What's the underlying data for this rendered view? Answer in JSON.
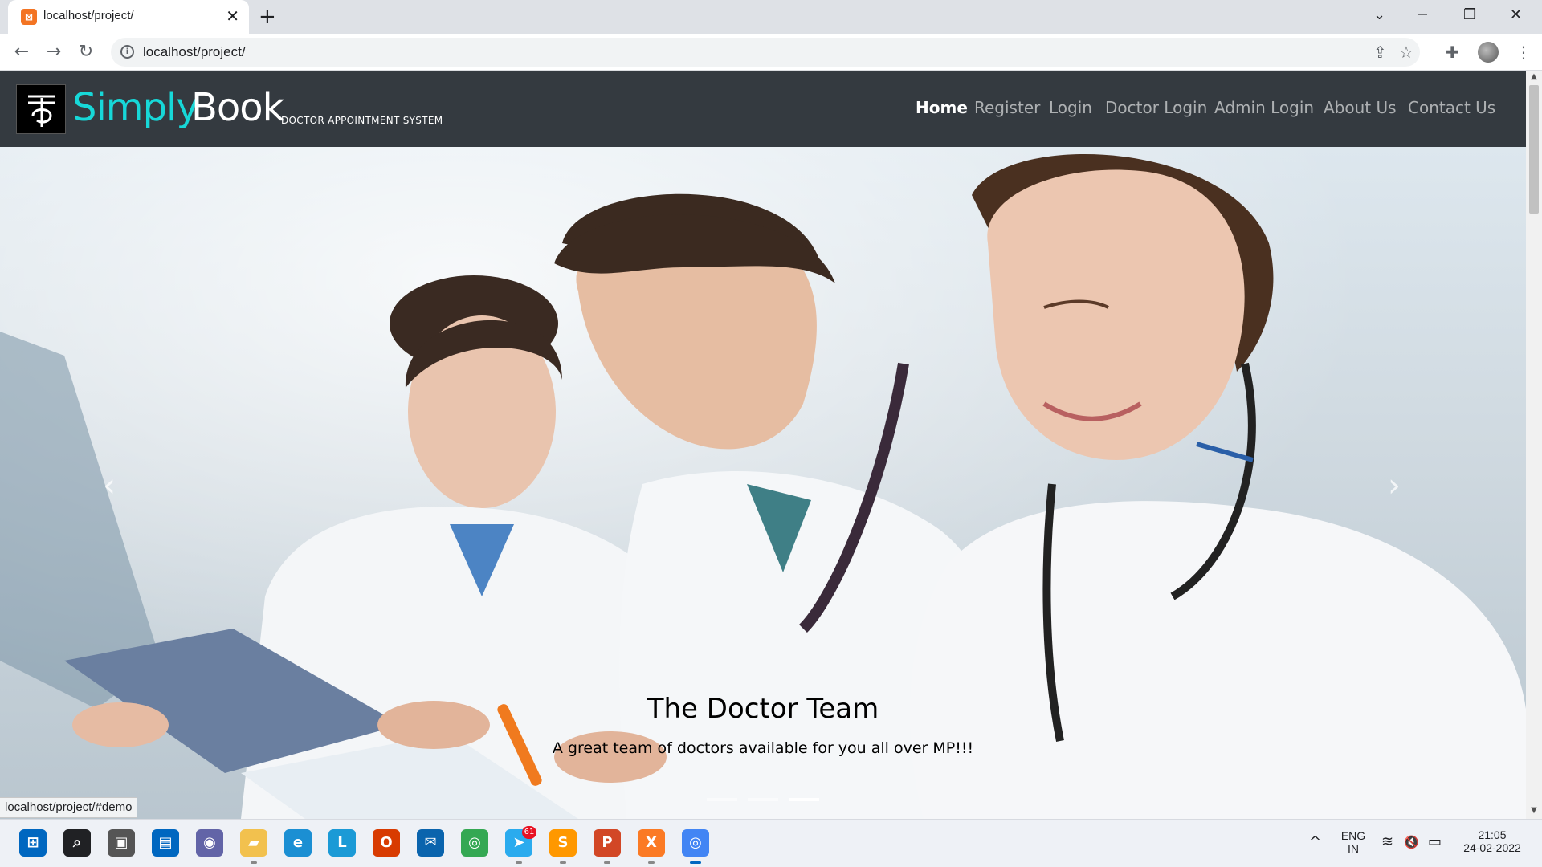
{
  "browser": {
    "tab_title": "localhost/project/",
    "tab_close_glyph": "✕",
    "new_tab_glyph": "+",
    "minimize_glyph": "─",
    "restore_glyph": "❐",
    "close_glyph": "✕",
    "tab_search_glyph": "⌄",
    "back_glyph": "←",
    "forward_glyph": "→",
    "reload_glyph": "↻",
    "url": "localhost/project/",
    "share_glyph": "⇪",
    "star_glyph": "☆",
    "extensions_glyph": "✚",
    "menu_glyph": "⋮",
    "status_url": "localhost/project/#demo"
  },
  "site": {
    "brand_part1": "Simply",
    "brand_part2": "Book",
    "brand_subtitle": "DOCTOR APPOINTMENT SYSTEM",
    "brand_color": "#17d8d8",
    "nav": [
      {
        "label": "Home",
        "active": true
      },
      {
        "label": "Register",
        "active": false
      },
      {
        "label": "Login",
        "active": false
      },
      {
        "label": "Doctor Login",
        "active": false
      },
      {
        "label": "Admin Login",
        "active": false
      },
      {
        "label": "About Us",
        "active": false
      },
      {
        "label": "Contact Us",
        "active": false
      }
    ]
  },
  "hero": {
    "caption_title": "The Doctor Team",
    "caption_text": "A great team of doctors available for you all over MP!!!",
    "prev_glyph": "‹",
    "next_glyph": "›",
    "slide_count": 3,
    "active_slide": 3
  },
  "taskbar": {
    "apps": [
      {
        "name": "windows-start",
        "glyph": "⊞",
        "color": "#0067c0"
      },
      {
        "name": "search",
        "glyph": "⌕",
        "color": "#202124"
      },
      {
        "name": "task-view",
        "glyph": "▣",
        "color": "#555555"
      },
      {
        "name": "widgets",
        "glyph": "▤",
        "color": "#0067c0"
      },
      {
        "name": "teams-chat",
        "glyph": "◉",
        "color": "#6264a7"
      },
      {
        "name": "file-explorer",
        "glyph": "▰",
        "color": "#f2c14e"
      },
      {
        "name": "edge",
        "glyph": "e",
        "color": "#1b8fd3"
      },
      {
        "name": "app-l",
        "glyph": "L",
        "color": "#1b9ad6"
      },
      {
        "name": "office",
        "glyph": "O",
        "color": "#d83b01"
      },
      {
        "name": "mail",
        "glyph": "✉",
        "color": "#0a64ad"
      },
      {
        "name": "chrome",
        "glyph": "◎",
        "color": "#34a853"
      },
      {
        "name": "telegram",
        "glyph": "➤",
        "color": "#2aabee"
      },
      {
        "name": "sublime-text",
        "glyph": "S",
        "color": "#ff9800"
      },
      {
        "name": "powerpoint",
        "glyph": "P",
        "color": "#d24726"
      },
      {
        "name": "xampp",
        "glyph": "X",
        "color": "#fb7a24"
      },
      {
        "name": "chrome-profile",
        "glyph": "◎",
        "color": "#4285f4"
      }
    ],
    "telegram_badge": "61",
    "language_line1": "ENG",
    "language_line2": "IN",
    "time": "21:05",
    "date": "24-02-2022",
    "tray_up_glyph": "^",
    "wifi_glyph": "≋",
    "volume_glyph": "🔇",
    "battery_glyph": "▭"
  }
}
